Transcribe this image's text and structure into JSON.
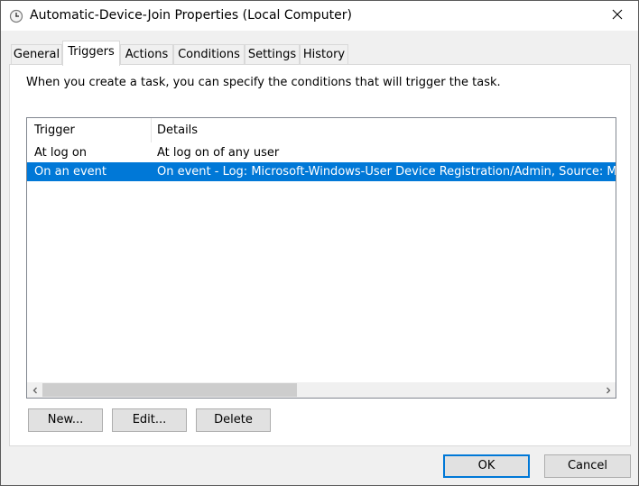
{
  "window": {
    "title": "Automatic-Device-Join Properties (Local Computer)"
  },
  "tabs": [
    {
      "label": "General",
      "active": false
    },
    {
      "label": "Triggers",
      "active": true
    },
    {
      "label": "Actions",
      "active": false
    },
    {
      "label": "Conditions",
      "active": false
    },
    {
      "label": "Settings",
      "active": false
    },
    {
      "label": "History",
      "active": false
    }
  ],
  "triggers_tab": {
    "description": "When you create a task, you can specify the conditions that will trigger the task.",
    "columns": [
      "Trigger",
      "Details"
    ],
    "rows": [
      {
        "trigger": "At log on",
        "details": "At log on of any user",
        "selected": false
      },
      {
        "trigger": "On an event",
        "details": "On event - Log: Microsoft-Windows-User Device Registration/Admin, Source: Microsoft-Windows-User Device Registration",
        "selected": true
      }
    ],
    "buttons": {
      "new": "New...",
      "edit": "Edit...",
      "delete": "Delete"
    }
  },
  "footer": {
    "ok": "OK",
    "cancel": "Cancel"
  },
  "colors": {
    "selection": "#0078d7",
    "default_button_border": "#0078d7"
  },
  "icons": {
    "title": "scheduled-task-clock-icon",
    "close": "close-icon",
    "scroll_left": "scroll-left-arrow-icon",
    "scroll_right": "scroll-right-arrow-icon"
  }
}
